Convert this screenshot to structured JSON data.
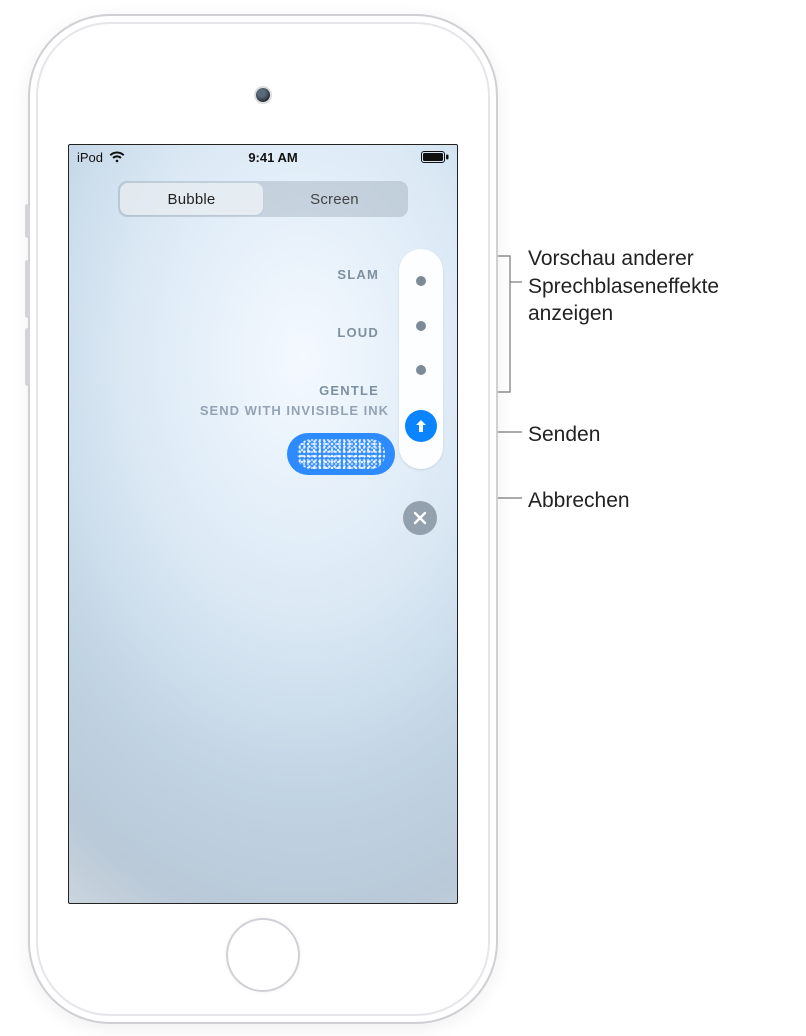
{
  "statusbar": {
    "device": "iPod",
    "time": "9:41 AM"
  },
  "segmented": {
    "bubble": "Bubble",
    "screen": "Screen"
  },
  "effects": {
    "slam": "SLAM",
    "loud": "LOUD",
    "gentle": "GENTLE",
    "active": "SEND WITH INVISIBLE INK"
  },
  "callouts": {
    "preview": "Vorschau anderer Sprechblaseneffekte anzeigen",
    "send": "Senden",
    "cancel": "Abbrechen"
  }
}
